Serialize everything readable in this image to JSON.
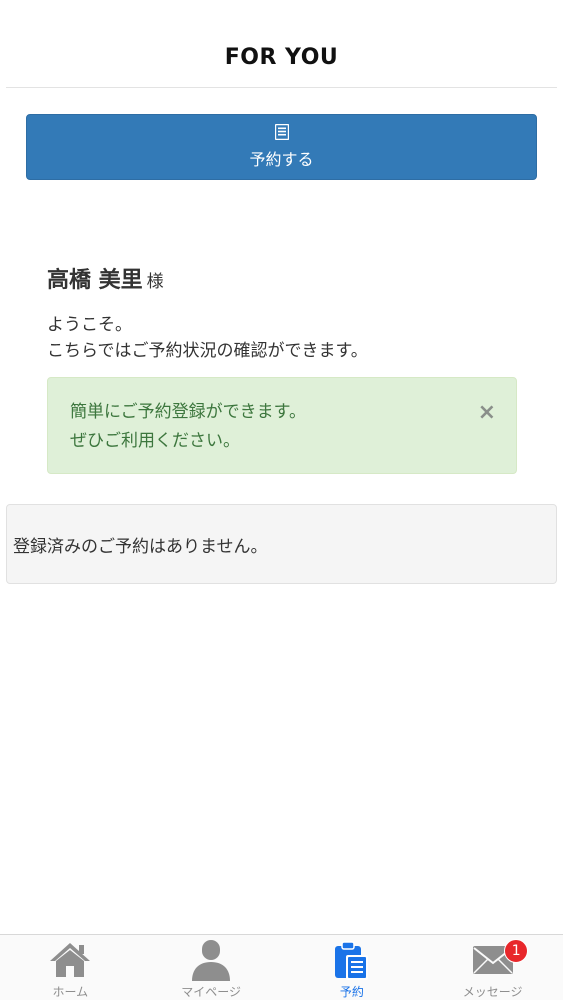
{
  "header": {
    "title": "FOR YOU"
  },
  "reserve_button": {
    "label": "予約する",
    "icon": "list-document-icon"
  },
  "greeting": {
    "name": "高橋 美里",
    "honorific": "様",
    "line1": "ようこそ。",
    "line2": "こちらではご予約状況の確認ができます。"
  },
  "alert": {
    "line1": "簡単にご予約登録ができます。",
    "line2": "ぜひご利用ください。",
    "close": "×"
  },
  "reservations": {
    "empty_message": "登録済みのご予約はありません。"
  },
  "tabbar": {
    "items": [
      {
        "label": "ホーム",
        "icon": "home-icon"
      },
      {
        "label": "マイページ",
        "icon": "person-icon"
      },
      {
        "label": "予約",
        "icon": "clipboard-icon",
        "active": true
      },
      {
        "label": "メッセージ",
        "icon": "envelope-icon",
        "badge": "1"
      }
    ]
  },
  "colors": {
    "primary": "#337ab7",
    "alert_bg": "#dff0d8",
    "alert_text": "#3c763d",
    "active_tab": "#1a73e8",
    "badge": "#e8272b"
  }
}
